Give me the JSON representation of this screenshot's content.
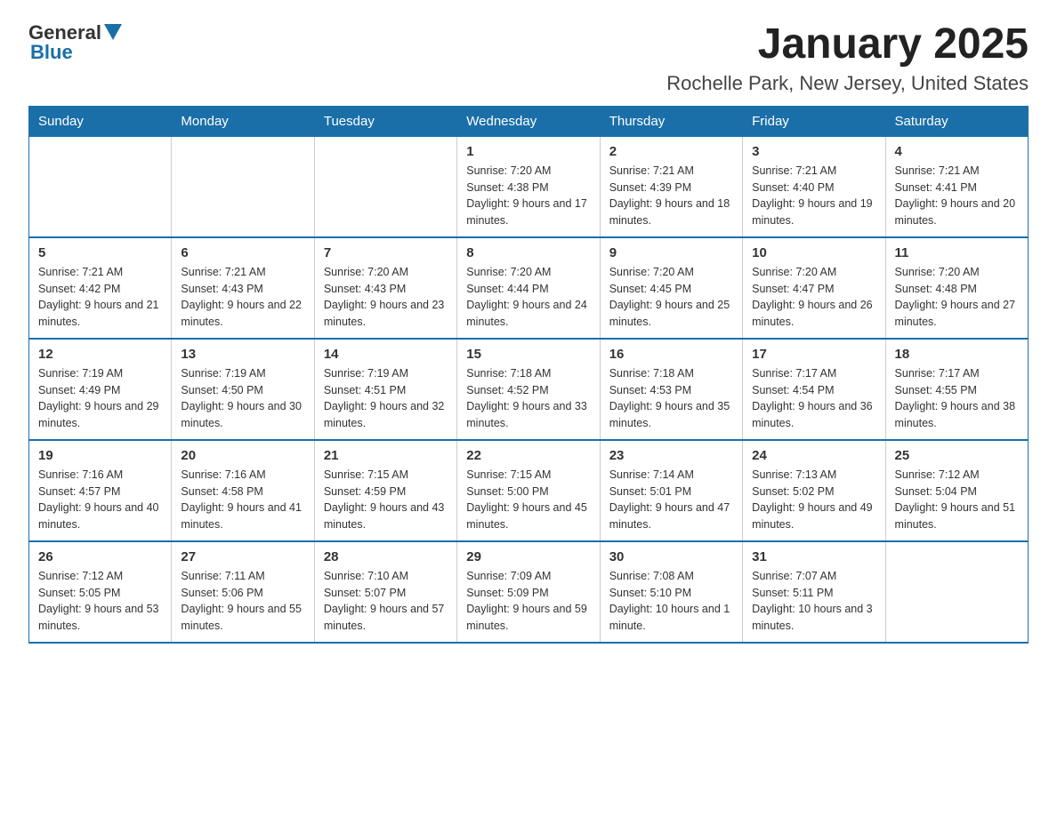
{
  "logo": {
    "general": "General",
    "blue": "Blue"
  },
  "title": "January 2025",
  "subtitle": "Rochelle Park, New Jersey, United States",
  "days_of_week": [
    "Sunday",
    "Monday",
    "Tuesday",
    "Wednesday",
    "Thursday",
    "Friday",
    "Saturday"
  ],
  "weeks": [
    [
      {
        "day": "",
        "info": ""
      },
      {
        "day": "",
        "info": ""
      },
      {
        "day": "",
        "info": ""
      },
      {
        "day": "1",
        "info": "Sunrise: 7:20 AM\nSunset: 4:38 PM\nDaylight: 9 hours\nand 17 minutes."
      },
      {
        "day": "2",
        "info": "Sunrise: 7:21 AM\nSunset: 4:39 PM\nDaylight: 9 hours\nand 18 minutes."
      },
      {
        "day": "3",
        "info": "Sunrise: 7:21 AM\nSunset: 4:40 PM\nDaylight: 9 hours\nand 19 minutes."
      },
      {
        "day": "4",
        "info": "Sunrise: 7:21 AM\nSunset: 4:41 PM\nDaylight: 9 hours\nand 20 minutes."
      }
    ],
    [
      {
        "day": "5",
        "info": "Sunrise: 7:21 AM\nSunset: 4:42 PM\nDaylight: 9 hours\nand 21 minutes."
      },
      {
        "day": "6",
        "info": "Sunrise: 7:21 AM\nSunset: 4:43 PM\nDaylight: 9 hours\nand 22 minutes."
      },
      {
        "day": "7",
        "info": "Sunrise: 7:20 AM\nSunset: 4:43 PM\nDaylight: 9 hours\nand 23 minutes."
      },
      {
        "day": "8",
        "info": "Sunrise: 7:20 AM\nSunset: 4:44 PM\nDaylight: 9 hours\nand 24 minutes."
      },
      {
        "day": "9",
        "info": "Sunrise: 7:20 AM\nSunset: 4:45 PM\nDaylight: 9 hours\nand 25 minutes."
      },
      {
        "day": "10",
        "info": "Sunrise: 7:20 AM\nSunset: 4:47 PM\nDaylight: 9 hours\nand 26 minutes."
      },
      {
        "day": "11",
        "info": "Sunrise: 7:20 AM\nSunset: 4:48 PM\nDaylight: 9 hours\nand 27 minutes."
      }
    ],
    [
      {
        "day": "12",
        "info": "Sunrise: 7:19 AM\nSunset: 4:49 PM\nDaylight: 9 hours\nand 29 minutes."
      },
      {
        "day": "13",
        "info": "Sunrise: 7:19 AM\nSunset: 4:50 PM\nDaylight: 9 hours\nand 30 minutes."
      },
      {
        "day": "14",
        "info": "Sunrise: 7:19 AM\nSunset: 4:51 PM\nDaylight: 9 hours\nand 32 minutes."
      },
      {
        "day": "15",
        "info": "Sunrise: 7:18 AM\nSunset: 4:52 PM\nDaylight: 9 hours\nand 33 minutes."
      },
      {
        "day": "16",
        "info": "Sunrise: 7:18 AM\nSunset: 4:53 PM\nDaylight: 9 hours\nand 35 minutes."
      },
      {
        "day": "17",
        "info": "Sunrise: 7:17 AM\nSunset: 4:54 PM\nDaylight: 9 hours\nand 36 minutes."
      },
      {
        "day": "18",
        "info": "Sunrise: 7:17 AM\nSunset: 4:55 PM\nDaylight: 9 hours\nand 38 minutes."
      }
    ],
    [
      {
        "day": "19",
        "info": "Sunrise: 7:16 AM\nSunset: 4:57 PM\nDaylight: 9 hours\nand 40 minutes."
      },
      {
        "day": "20",
        "info": "Sunrise: 7:16 AM\nSunset: 4:58 PM\nDaylight: 9 hours\nand 41 minutes."
      },
      {
        "day": "21",
        "info": "Sunrise: 7:15 AM\nSunset: 4:59 PM\nDaylight: 9 hours\nand 43 minutes."
      },
      {
        "day": "22",
        "info": "Sunrise: 7:15 AM\nSunset: 5:00 PM\nDaylight: 9 hours\nand 45 minutes."
      },
      {
        "day": "23",
        "info": "Sunrise: 7:14 AM\nSunset: 5:01 PM\nDaylight: 9 hours\nand 47 minutes."
      },
      {
        "day": "24",
        "info": "Sunrise: 7:13 AM\nSunset: 5:02 PM\nDaylight: 9 hours\nand 49 minutes."
      },
      {
        "day": "25",
        "info": "Sunrise: 7:12 AM\nSunset: 5:04 PM\nDaylight: 9 hours\nand 51 minutes."
      }
    ],
    [
      {
        "day": "26",
        "info": "Sunrise: 7:12 AM\nSunset: 5:05 PM\nDaylight: 9 hours\nand 53 minutes."
      },
      {
        "day": "27",
        "info": "Sunrise: 7:11 AM\nSunset: 5:06 PM\nDaylight: 9 hours\nand 55 minutes."
      },
      {
        "day": "28",
        "info": "Sunrise: 7:10 AM\nSunset: 5:07 PM\nDaylight: 9 hours\nand 57 minutes."
      },
      {
        "day": "29",
        "info": "Sunrise: 7:09 AM\nSunset: 5:09 PM\nDaylight: 9 hours\nand 59 minutes."
      },
      {
        "day": "30",
        "info": "Sunrise: 7:08 AM\nSunset: 5:10 PM\nDaylight: 10 hours\nand 1 minute."
      },
      {
        "day": "31",
        "info": "Sunrise: 7:07 AM\nSunset: 5:11 PM\nDaylight: 10 hours\nand 3 minutes."
      },
      {
        "day": "",
        "info": ""
      }
    ]
  ]
}
